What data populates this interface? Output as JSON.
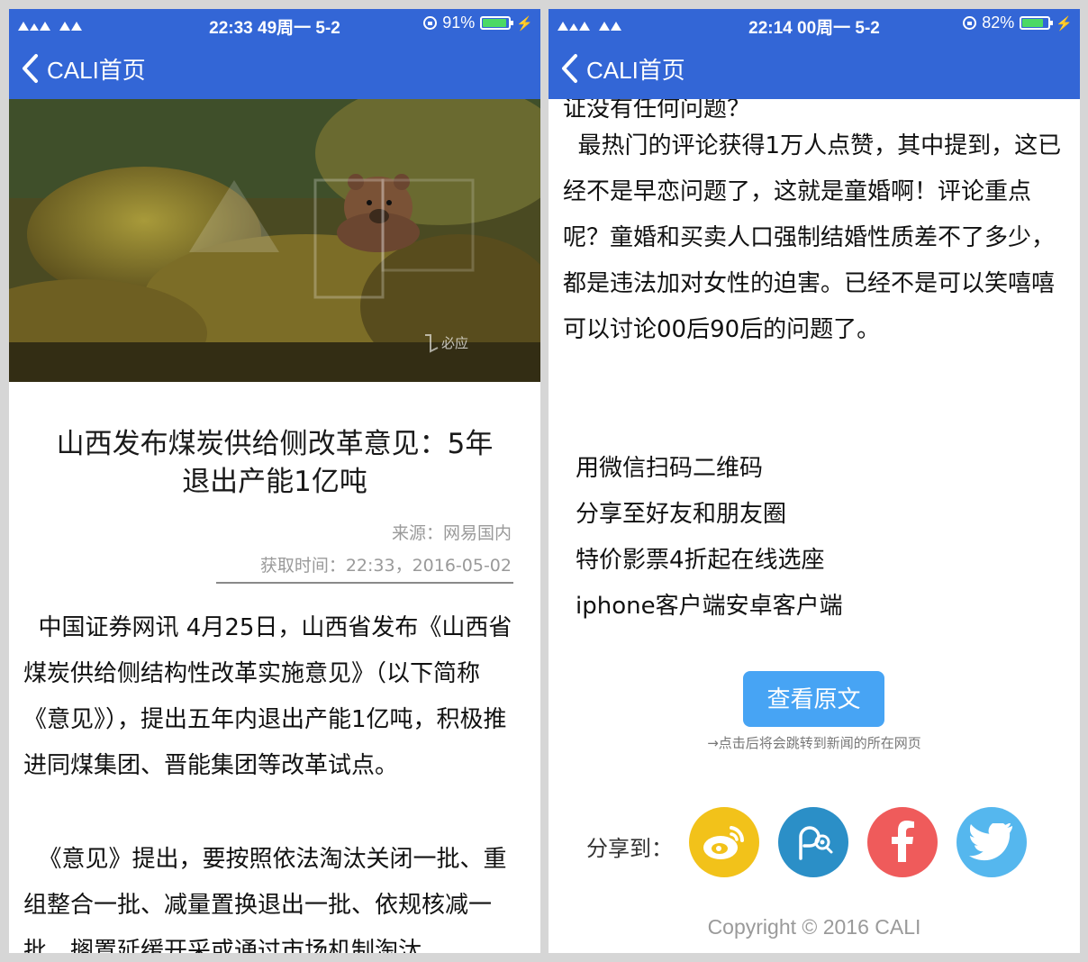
{
  "left": {
    "status": {
      "time": "22:33 49周一 5-2",
      "battery": "91%",
      "battery_level": 0.91
    },
    "nav": {
      "title": "CALI首页"
    },
    "hero": {
      "watermark": "必应"
    },
    "article": {
      "title": "山西发布煤炭供给侧改革意见：5年退出产能1亿吨",
      "source": "来源：网易国内",
      "time": "获取时间：22:33，2016-05-02",
      "para1": "  中国证券网讯 4月25日，山西省发布《山西省煤炭供给侧结构性改革实施意见》（以下简称《意见》），提出五年内退出产能1亿吨，积极推进同煤集团、晋能集团等改革试点。",
      "para2": "  《意见》提出，要按照依法淘汰关闭一批、重组整合一批、减量置换退出一批、依规核减一批、搁置延缓开采或通过市场机制淘汰"
    }
  },
  "right": {
    "status": {
      "time": "22:14 00周一 5-2",
      "battery": "82%",
      "battery_level": 0.82
    },
    "nav": {
      "title": "CALI首页"
    },
    "article": {
      "partial_line": "证没有任何问题？",
      "para": "  最热门的评论获得1万人点赞，其中提到，这已经不是早恋问题了，这就是童婚啊！评论重点呢？童婚和买卖人口强制结婚性质差不了多少，都是违法加对女性的迫害。已经不是可以笑嘻嘻可以讨论00后90后的问题了。"
    },
    "promo": [
      "用微信扫码二维码",
      "分享至好友和朋友圈",
      "特价影票4折起在线选座",
      "iphone客户端安卓客户端"
    ],
    "view_button": "查看原文",
    "redirect_hint": "→点击后将会跳转到新闻的所在网页",
    "share_label": "分享到：",
    "share_icons": [
      "weibo-icon",
      "wechat-moments-icon",
      "facebook-icon",
      "twitter-icon"
    ],
    "copyright": "Copyright © 2016 CALI"
  },
  "colors": {
    "nav_bar": "#3366d6",
    "view_button": "#47a4f4",
    "weibo": "#f2c21a",
    "wechat": "#2b8fc7",
    "facebook": "#ef5b5b",
    "twitter": "#55b7ee",
    "battery_fill": "#4cd964"
  }
}
